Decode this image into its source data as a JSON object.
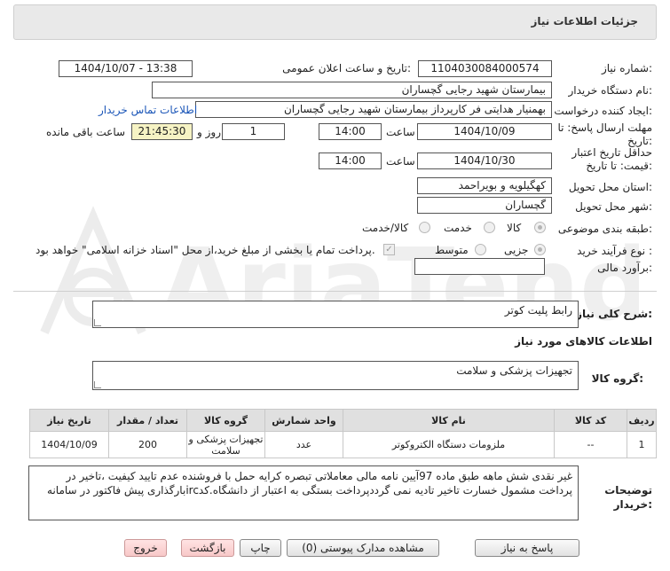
{
  "header": {
    "title": "جزئیات اطلاعات نیاز"
  },
  "watermark": {
    "text": "AriaTender.neT"
  },
  "form": {
    "need_number": {
      "label": "شماره نیاز:",
      "value": "1104030084000574"
    },
    "announce_datetime": {
      "label": "تاریخ و ساعت اعلان عمومی:",
      "value": "1404/10/07 - 13:38"
    },
    "buyer_org": {
      "label": "نام دستگاه خریدار:",
      "value": "بیمارستان شهید رجایی گچساران"
    },
    "creator": {
      "label": "ایجاد کننده درخواست:",
      "value": "بهمنیار هدایتی فر کارپرداز بیمارستان شهید رجایی گچساران"
    },
    "contact_link": "اطلاعات تماس خریدار",
    "reply_deadline": {
      "label": "مهلت ارسال پاسخ: تا تاریخ:",
      "date": "1404/10/09",
      "time_label": "ساعت",
      "time": "14:00",
      "days": "1",
      "days_label": "روز و",
      "remaining": "21:45:30",
      "remaining_label": "ساعت باقی مانده"
    },
    "price_validity": {
      "label": "حداقل تاریخ اعتبار قیمت: تا تاریخ:",
      "date": "1404/10/30",
      "time_label": "ساعت",
      "time": "14:00"
    },
    "province": {
      "label": "استان محل تحویل:",
      "value": "کهگیلویه و بویراحمد"
    },
    "city": {
      "label": "شهر محل تحویل:",
      "value": "گچساران"
    },
    "category": {
      "label": "طبقه بندی موضوعی:",
      "options": [
        "کالا",
        "خدمت",
        "کالا/خدمت"
      ],
      "selected": "کالا"
    },
    "purchase_process": {
      "label": "نوع فرآیند خرید :",
      "options": [
        "جزیی",
        "متوسط"
      ],
      "selected": "جزیی",
      "treasury_note": "پرداخت تمام یا بخشی از مبلغ خرید،از محل \"اسناد خزانه اسلامی\" خواهد بود."
    },
    "financial_estimate": {
      "label": "برآورد مالی:",
      "value": ""
    }
  },
  "description": {
    "label": "شرح کلی نیاز:",
    "value": "رابط پلیت کوتر"
  },
  "goods_info": {
    "title": "اطلاعات کالاهای مورد نیاز",
    "group_label": "گروه کالا:",
    "group_value": "تجهیزات پزشکی و سلامت"
  },
  "table": {
    "headers": [
      "ردیف",
      "کد کالا",
      "نام کالا",
      "واحد شمارش",
      "گروه کالا",
      "تعداد / مقدار",
      "تاریخ نیاز"
    ],
    "rows": [
      {
        "row": "1",
        "code": "--",
        "name": "ملزومات دستگاه الکتروکوتر",
        "unit": "عدد",
        "group": "تجهیزات پزشکی و سلامت",
        "qty": "200",
        "date": "1404/10/09"
      }
    ]
  },
  "buyer_notes": {
    "label": "توضیحات خریدار:",
    "value": "غیر نقدی شش ماهه طبق ماده 97آیین نامه مالی معاملاتی تبصره کرایه حمل با فروشنده عدم تایید کیفیت ،تاخیر در پرداخت مشمول خسارت تاخیر تادیه نمی گرددپرداخت بستگی به اعتبار از دانشگاه.کدircبارگذاری پیش فاکتور در سامانه"
  },
  "buttons": {
    "reply": "پاسخ به نیاز",
    "attachments": "مشاهده مدارک پیوستی (0)",
    "print": "چاپ",
    "back": "بازگشت",
    "exit": "خروج"
  }
}
